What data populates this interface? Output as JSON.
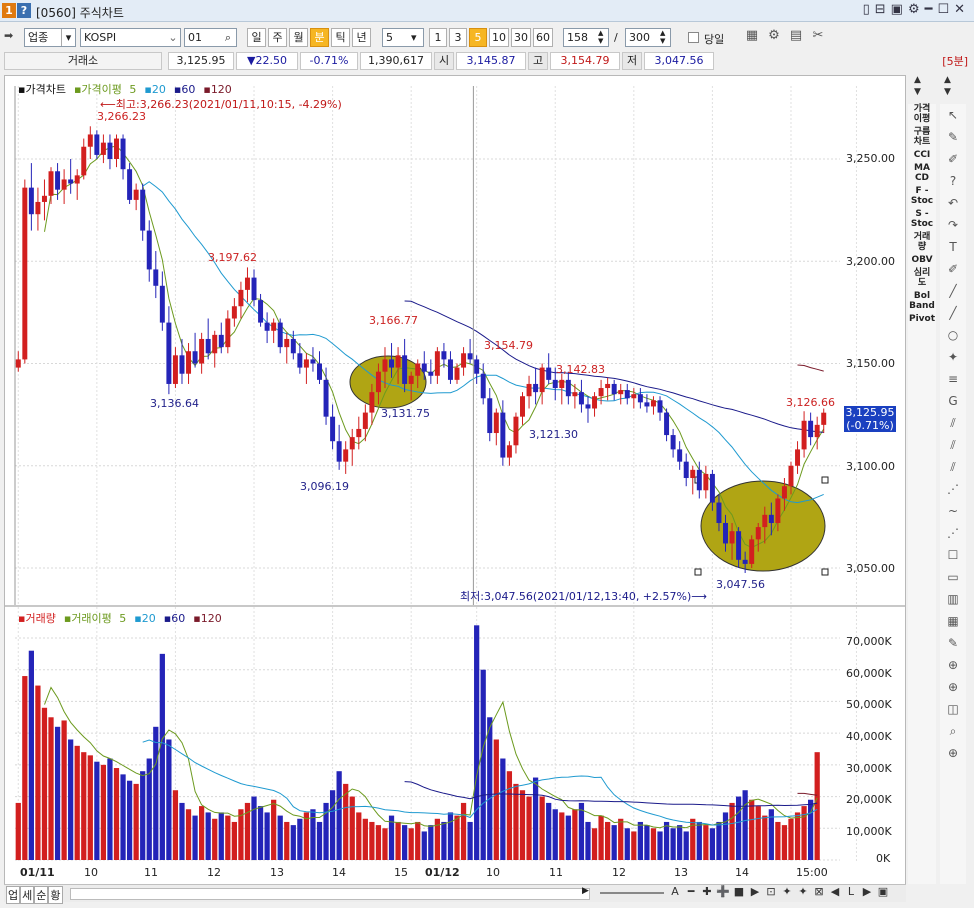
{
  "window": {
    "badge1": "1",
    "badge2": "?",
    "title": "[0560] 주식차트",
    "controls": [
      "▯",
      "⊟",
      "▣",
      "⚙",
      "━",
      "☐",
      "✕"
    ]
  },
  "toolbar": {
    "market": "업종",
    "index": "KOSPI",
    "code": "01",
    "periods": [
      "일",
      "주",
      "월",
      "분",
      "틱",
      "년"
    ],
    "active_period": "분",
    "interval": "5",
    "intervals": [
      "1",
      "3",
      "5",
      "10",
      "30",
      "60"
    ],
    "active_interval": "5",
    "count": "158",
    "slash": "/",
    "total": "300",
    "today_label": "당일"
  },
  "info": {
    "exchange": "거래소",
    "price": "3,125.95",
    "change": "▼22.50",
    "rate": "-0.71%",
    "volume": "1,390,617",
    "open_label": "시",
    "open": "3,145.87",
    "high_label": "고",
    "high": "3,154.79",
    "low_label": "저",
    "low": "3,047.56",
    "period_badge": "[5분]"
  },
  "legend_price": {
    "name": "가격차트",
    "ma_name": "가격이평",
    "p1": "5",
    "p2": "20",
    "p3": "60",
    "p4": "120"
  },
  "legend_volume": {
    "name": "거래량",
    "ma_name": "거래이평",
    "p1": "5",
    "p2": "20",
    "p3": "60",
    "p4": "120"
  },
  "annotations": {
    "max_text": "⟵최고:3,266.23(2021/01/11,10:15, -4.29%)",
    "min_text": "최저:3,047.56(2021/01/12,13:40, +2.57%)⟶",
    "current_price": "3,125.95",
    "current_rate": "(-0.71%)",
    "labels": [
      {
        "text": "3,266.23",
        "color": "#cc2222"
      },
      {
        "text": "3,197.62",
        "color": "#cc2222"
      },
      {
        "text": "3,166.77",
        "color": "#cc2222"
      },
      {
        "text": "3,154.79",
        "color": "#cc2222"
      },
      {
        "text": "3,142.83",
        "color": "#cc2222"
      },
      {
        "text": "3,126.66",
        "color": "#cc2222"
      },
      {
        "text": "3,136.64",
        "color": "#22228a"
      },
      {
        "text": "3,096.19",
        "color": "#22228a"
      },
      {
        "text": "3,131.75",
        "color": "#22228a"
      },
      {
        "text": "3,121.30",
        "color": "#22228a"
      },
      {
        "text": "3,047.56",
        "color": "#22228a"
      }
    ]
  },
  "price_axis": [
    "3,250.00",
    "3,200.00",
    "3,150.00",
    "3,100.00",
    "3,050.00"
  ],
  "volume_axis": [
    "70,000K",
    "60,000K",
    "50,000K",
    "40,000K",
    "30,000K",
    "20,000K",
    "10,000K",
    "0K"
  ],
  "time_axis": [
    "01/11",
    "10",
    "11",
    "12",
    "13",
    "14",
    "15",
    "01/12",
    "10",
    "11",
    "12",
    "13",
    "14",
    "15:00"
  ],
  "side_indicators": [
    "가격\n이평",
    "구름\n차트",
    "CCI",
    "MA\nCD",
    "F -\nStoc",
    "S -\nStoc",
    "거래\n량",
    "OBV",
    "심리\n도",
    "Bol\nBand",
    "Pivot"
  ],
  "right_tools": [
    "↖",
    "✎",
    "✐",
    "?",
    "↶",
    "↷",
    "T",
    "✐",
    "╱",
    "╱",
    "○",
    "✦",
    "≡",
    "G",
    "⫽",
    "⫽",
    "⫽",
    "⋰",
    "~",
    "⋰",
    "☐",
    "▭",
    "▥",
    "▦",
    "✎",
    "⊕",
    "⊕",
    "◫",
    "⌕",
    "⊕"
  ],
  "bottom_tabs": [
    "업",
    "세",
    "순",
    "황"
  ],
  "bottom_tools": [
    "A",
    "━",
    "✚",
    "➕",
    "■",
    "▶",
    "⊡",
    "✦",
    "✦",
    "⊠",
    "◀",
    "L",
    "▶",
    "▣"
  ],
  "colors": {
    "up": "#d21f1f",
    "down": "#2424b8",
    "ma5": "#6c9a1e",
    "ma20": "#1f9ad0",
    "ma60": "#1a1a8a",
    "ma120": "#7a1a2a",
    "highlight": "#b0a514"
  },
  "chart_data": {
    "type": "candlestick",
    "price_ylim": [
      3040,
      3275
    ],
    "volume_ylim": [
      0,
      76000
    ],
    "sessions": [
      {
        "day": "01/11"
      },
      {
        "day": "01/12"
      }
    ],
    "ohlc": [
      [
        3148,
        3156,
        3146,
        3152
      ],
      [
        3152,
        3240,
        3150,
        3236
      ],
      [
        3236,
        3248,
        3215,
        3223
      ],
      [
        3223,
        3236,
        3215,
        3229
      ],
      [
        3229,
        3240,
        3220,
        3232
      ],
      [
        3232,
        3246,
        3228,
        3244
      ],
      [
        3244,
        3248,
        3230,
        3235
      ],
      [
        3235,
        3245,
        3228,
        3240
      ],
      [
        3240,
        3250,
        3233,
        3238
      ],
      [
        3238,
        3245,
        3230,
        3242
      ],
      [
        3242,
        3260,
        3240,
        3256
      ],
      [
        3256,
        3266,
        3250,
        3262
      ],
      [
        3262,
        3264,
        3250,
        3252
      ],
      [
        3252,
        3262,
        3248,
        3258
      ],
      [
        3258,
        3262,
        3245,
        3250
      ],
      [
        3250,
        3262,
        3246,
        3260
      ],
      [
        3260,
        3262,
        3240,
        3245
      ],
      [
        3245,
        3248,
        3228,
        3230
      ],
      [
        3230,
        3238,
        3225,
        3235
      ],
      [
        3235,
        3238,
        3210,
        3215
      ],
      [
        3215,
        3220,
        3190,
        3196
      ],
      [
        3196,
        3205,
        3182,
        3188
      ],
      [
        3188,
        3195,
        3166,
        3170
      ],
      [
        3170,
        3178,
        3135,
        3140
      ],
      [
        3140,
        3158,
        3138,
        3154
      ],
      [
        3154,
        3162,
        3140,
        3145
      ],
      [
        3145,
        3160,
        3140,
        3156
      ],
      [
        3156,
        3165,
        3148,
        3150
      ],
      [
        3150,
        3165,
        3145,
        3162
      ],
      [
        3162,
        3172,
        3152,
        3155
      ],
      [
        3155,
        3166,
        3148,
        3164
      ],
      [
        3164,
        3170,
        3155,
        3158
      ],
      [
        3158,
        3176,
        3155,
        3172
      ],
      [
        3172,
        3182,
        3168,
        3178
      ],
      [
        3178,
        3190,
        3172,
        3186
      ],
      [
        3186,
        3197,
        3180,
        3192
      ],
      [
        3192,
        3196,
        3178,
        3181
      ],
      [
        3181,
        3184,
        3168,
        3170
      ],
      [
        3170,
        3175,
        3160,
        3166
      ],
      [
        3166,
        3172,
        3160,
        3170
      ],
      [
        3170,
        3172,
        3155,
        3158
      ],
      [
        3158,
        3165,
        3150,
        3162
      ],
      [
        3162,
        3166,
        3152,
        3155
      ],
      [
        3155,
        3160,
        3145,
        3148
      ],
      [
        3148,
        3155,
        3140,
        3152
      ],
      [
        3152,
        3158,
        3146,
        3150
      ],
      [
        3150,
        3156,
        3140,
        3142
      ],
      [
        3142,
        3148,
        3120,
        3124
      ],
      [
        3124,
        3130,
        3108,
        3112
      ],
      [
        3112,
        3120,
        3098,
        3102
      ],
      [
        3102,
        3112,
        3096,
        3108
      ],
      [
        3108,
        3118,
        3100,
        3114
      ],
      [
        3114,
        3124,
        3108,
        3118
      ],
      [
        3118,
        3130,
        3112,
        3126
      ],
      [
        3126,
        3140,
        3120,
        3136
      ],
      [
        3136,
        3150,
        3130,
        3146
      ],
      [
        3146,
        3158,
        3138,
        3152
      ],
      [
        3152,
        3160,
        3143,
        3148
      ],
      [
        3148,
        3158,
        3140,
        3154
      ],
      [
        3154,
        3162,
        3136,
        3140
      ],
      [
        3140,
        3146,
        3132,
        3144
      ],
      [
        3144,
        3152,
        3138,
        3150
      ],
      [
        3150,
        3156,
        3142,
        3146
      ],
      [
        3146,
        3152,
        3140,
        3144
      ],
      [
        3144,
        3158,
        3140,
        3156
      ],
      [
        3156,
        3160,
        3148,
        3152
      ],
      [
        3152,
        3156,
        3140,
        3142
      ],
      [
        3142,
        3150,
        3140,
        3148
      ],
      [
        3148,
        3158,
        3144,
        3155
      ],
      [
        3155,
        3162,
        3150,
        3152
      ],
      [
        3152,
        3154,
        3140,
        3145
      ],
      [
        3145,
        3150,
        3130,
        3133
      ],
      [
        3133,
        3138,
        3112,
        3116
      ],
      [
        3116,
        3128,
        3110,
        3126
      ],
      [
        3126,
        3132,
        3100,
        3104
      ],
      [
        3104,
        3112,
        3100,
        3110
      ],
      [
        3110,
        3126,
        3106,
        3124
      ],
      [
        3124,
        3136,
        3120,
        3134
      ],
      [
        3134,
        3144,
        3128,
        3140
      ],
      [
        3140,
        3148,
        3130,
        3136
      ],
      [
        3136,
        3150,
        3130,
        3148
      ],
      [
        3148,
        3155,
        3140,
        3142
      ],
      [
        3142,
        3148,
        3132,
        3138
      ],
      [
        3138,
        3145,
        3130,
        3142
      ],
      [
        3142,
        3146,
        3130,
        3134
      ],
      [
        3134,
        3140,
        3128,
        3136
      ],
      [
        3136,
        3142,
        3126,
        3130
      ],
      [
        3130,
        3134,
        3121,
        3128
      ],
      [
        3128,
        3136,
        3124,
        3134
      ],
      [
        3134,
        3142,
        3130,
        3138
      ],
      [
        3138,
        3143,
        3132,
        3140
      ],
      [
        3140,
        3142,
        3132,
        3135
      ],
      [
        3135,
        3140,
        3130,
        3137
      ],
      [
        3137,
        3140,
        3130,
        3133
      ],
      [
        3133,
        3138,
        3128,
        3135
      ],
      [
        3135,
        3138,
        3128,
        3131
      ],
      [
        3131,
        3135,
        3126,
        3129
      ],
      [
        3129,
        3134,
        3125,
        3132
      ],
      [
        3132,
        3134,
        3122,
        3126
      ],
      [
        3126,
        3128,
        3112,
        3115
      ],
      [
        3115,
        3118,
        3104,
        3108
      ],
      [
        3108,
        3112,
        3098,
        3102
      ],
      [
        3102,
        3106,
        3090,
        3094
      ],
      [
        3094,
        3100,
        3086,
        3098
      ],
      [
        3098,
        3102,
        3084,
        3088
      ],
      [
        3088,
        3100,
        3084,
        3096
      ],
      [
        3096,
        3098,
        3078,
        3082
      ],
      [
        3082,
        3086,
        3068,
        3072
      ],
      [
        3072,
        3076,
        3058,
        3062
      ],
      [
        3062,
        3072,
        3054,
        3068
      ],
      [
        3068,
        3070,
        3050,
        3054
      ],
      [
        3054,
        3058,
        3047.56,
        3052
      ],
      [
        3052,
        3066,
        3050,
        3064
      ],
      [
        3064,
        3072,
        3058,
        3070
      ],
      [
        3070,
        3080,
        3062,
        3076
      ],
      [
        3076,
        3082,
        3066,
        3072
      ],
      [
        3072,
        3086,
        3068,
        3084
      ],
      [
        3084,
        3094,
        3078,
        3090
      ],
      [
        3090,
        3102,
        3086,
        3100
      ],
      [
        3100,
        3112,
        3096,
        3108
      ],
      [
        3108,
        3126.66,
        3104,
        3122
      ],
      [
        3122,
        3126,
        3110,
        3114
      ],
      [
        3114,
        3124,
        3108,
        3120
      ],
      [
        3120,
        3128,
        3116,
        3125.95
      ]
    ],
    "volume": [
      18000,
      58000,
      66000,
      55000,
      48000,
      45000,
      42000,
      44000,
      38000,
      36000,
      34000,
      33000,
      31000,
      30000,
      32000,
      29000,
      27000,
      25000,
      24000,
      28000,
      32000,
      42000,
      65000,
      38000,
      22000,
      18000,
      16000,
      14000,
      17000,
      15000,
      13000,
      15000,
      14000,
      12000,
      16000,
      18000,
      20000,
      17000,
      15000,
      19000,
      14000,
      12000,
      11000,
      13000,
      15000,
      16000,
      12000,
      18000,
      22000,
      28000,
      24000,
      20000,
      15000,
      13000,
      12000,
      11000,
      10000,
      14000,
      12000,
      11000,
      10000,
      12000,
      9000,
      11000,
      13000,
      12000,
      15000,
      14000,
      18000,
      12000,
      74000,
      60000,
      45000,
      38000,
      32000,
      28000,
      24000,
      22000,
      20000,
      26000,
      20000,
      18000,
      16000,
      15000,
      14000,
      16000,
      18000,
      12000,
      10000,
      14000,
      12000,
      11000,
      13000,
      10000,
      9000,
      12000,
      11000,
      10000,
      9000,
      12000,
      10000,
      11000,
      9000,
      13000,
      12000,
      11000,
      10000,
      12000,
      15000,
      18000,
      20000,
      22000,
      19000,
      17000,
      14000,
      16000,
      12000,
      11000,
      13000,
      15000,
      17000,
      19000,
      34000
    ]
  }
}
